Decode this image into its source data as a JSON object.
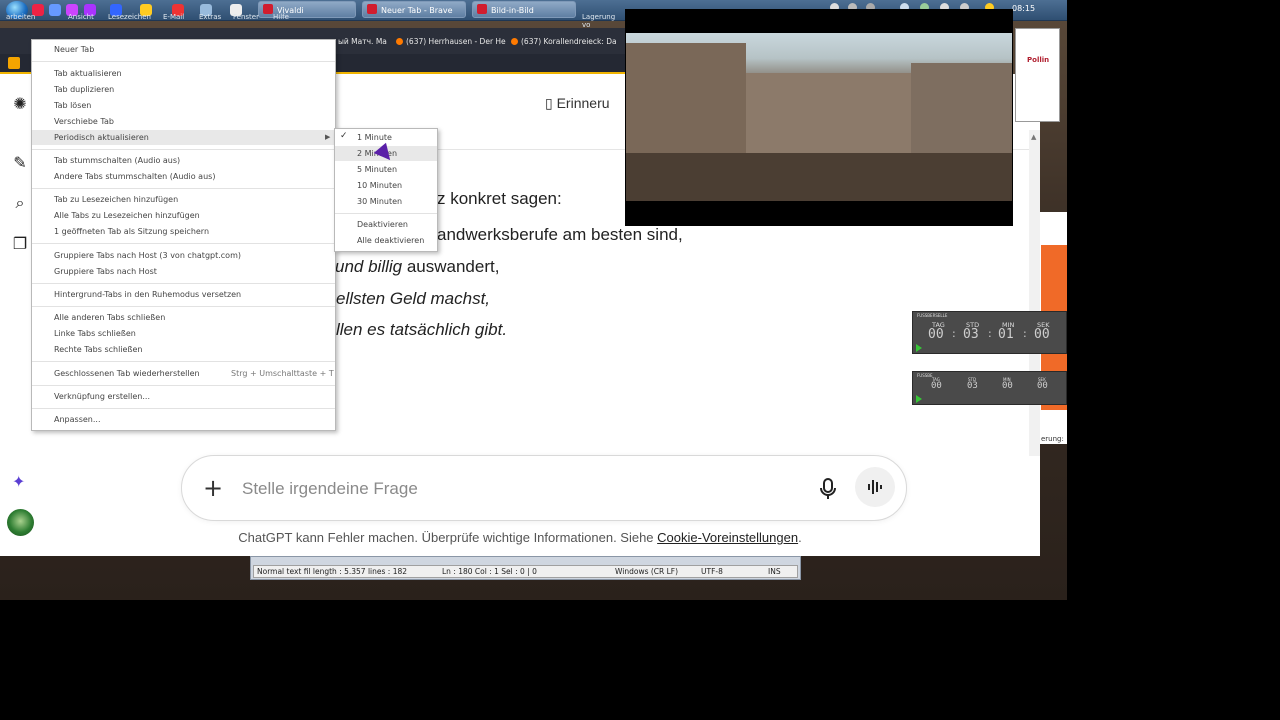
{
  "taskbar": {
    "tasks": [
      {
        "label": "Vivaldi"
      },
      {
        "label": "Neuer Tab - Brave"
      },
      {
        "label": "Bild-in-Bild"
      }
    ],
    "clock": "08:15"
  },
  "menubar": {
    "items": [
      "arbeiten",
      "Ansicht",
      "Lesezeichen",
      "E-Mail",
      "Extras",
      "Fenster",
      "Hilfe"
    ],
    "right_text": "Lagerung vo"
  },
  "browser_tabs": [
    {
      "label": "ый Матч. Ма"
    },
    {
      "label": "(637) Herrhausen - Der He"
    },
    {
      "label": "(637) Korallendreieck: Da"
    }
  ],
  "page": {
    "header_button": "Erinneru",
    "lines": [
      {
        "prefix": "z konkret sagen:",
        "italic": ""
      },
      {
        "prefix": "andwerksberufe am besten sind,",
        "italic": ""
      },
      {
        "italic": "und billig",
        "suffix": " auswandert,"
      },
      {
        "italic": "ellsten Geld machst,",
        "suffix": ""
      },
      {
        "italic": "llen es tatsächlich gibt.",
        "suffix": ""
      }
    ],
    "composer_placeholder": "Stelle irgendeine Frage",
    "footer_text": "ChatGPT kann Fehler machen. Überprüfe wichtige Informationen. Siehe ",
    "footer_link": "Cookie-Voreinstellungen",
    "footer_end": "."
  },
  "context_menu": {
    "items": [
      "Neuer Tab",
      "Tab aktualisieren",
      "Tab duplizieren",
      "Tab lösen",
      "Verschiebe Tab",
      "Periodisch aktualisieren",
      "Tab stummschalten (Audio aus)",
      "Andere Tabs stummschalten (Audio aus)",
      "Tab zu Lesezeichen hinzufügen",
      "Alle Tabs zu Lesezeichen hinzufügen",
      "1 geöffneten Tab als Sitzung speichern",
      "Gruppiere Tabs nach Host (3 von chatgpt.com)",
      "Gruppiere Tabs nach Host",
      "Hintergrund-Tabs in den Ruhemodus versetzen",
      "Alle anderen Tabs schließen",
      "Linke Tabs schließen",
      "Rechte Tabs schließen",
      "Geschlossenen Tab wiederherstellen",
      "Verknüpfung erstellen...",
      "Anpassen..."
    ],
    "shortcut": "Strg + Umschalttaste + T",
    "highlighted": "Periodisch aktualisieren"
  },
  "submenu": {
    "items": [
      "1 Minute",
      "2 Minuten",
      "5 Minuten",
      "10 Minuten",
      "30 Minuten",
      "Deaktivieren",
      "Alle deaktivieren"
    ],
    "checked": "1 Minute"
  },
  "editor_status": {
    "doc": "Normal text fil length : 5.357   lines : 182",
    "pos": "Ln : 180   Col : 1   Sel : 0 | 0",
    "eol": "Windows (CR LF)",
    "enc": "UTF-8",
    "mode": "INS"
  },
  "timers": [
    {
      "title": "FUSSBERSELLE",
      "labels": [
        "TAG",
        "STD",
        "MIN",
        "SEK"
      ],
      "values": [
        "00",
        "03",
        "01",
        "00"
      ]
    },
    {
      "title": "FUSSBE",
      "labels": [
        "TAG",
        "STD",
        "MIN",
        "SEK"
      ],
      "values": [
        "00",
        "03",
        "00",
        "00"
      ]
    }
  ],
  "right_window": {
    "logo": "Pollin",
    "bottom_text": "erung:"
  },
  "colors": {
    "accent_yellow": "#f0b400",
    "vivaldi_red": "#d11d2f",
    "orange_panel": "#f06a28",
    "cursor_purple": "#5a1fa8"
  }
}
